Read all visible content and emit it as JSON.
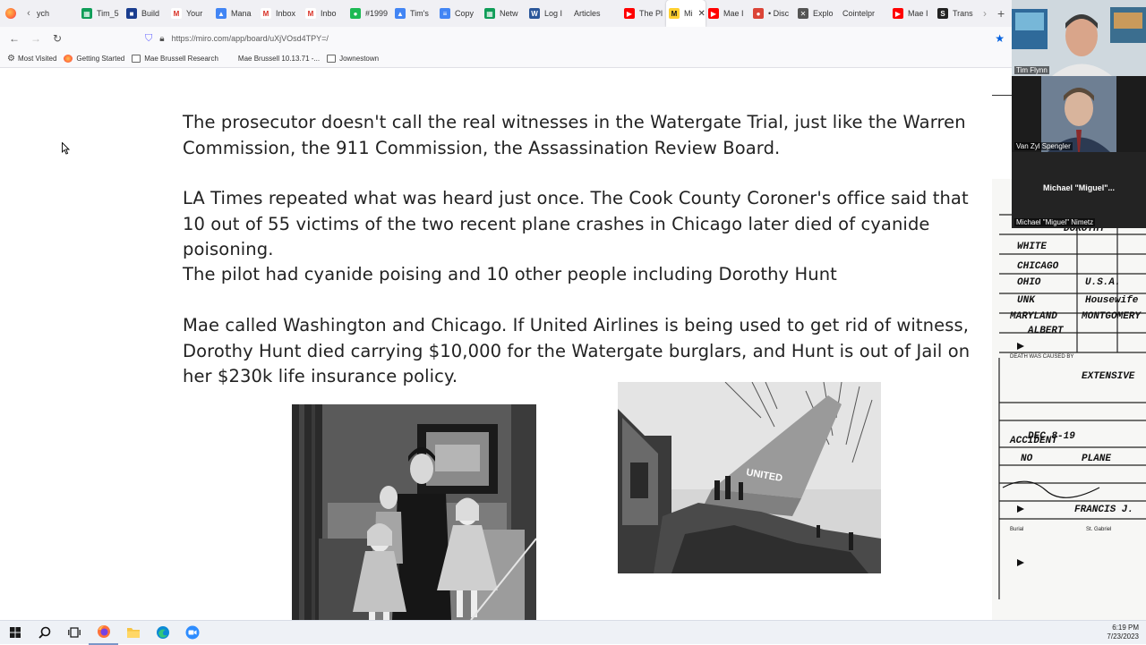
{
  "browser": {
    "tabs": [
      {
        "label": "ych",
        "icon": "none",
        "color": "#9aa0a6",
        "active": false
      },
      {
        "label": "Tim_5",
        "icon": "sheets",
        "color": "#0f9d58",
        "active": false
      },
      {
        "label": "Build",
        "icon": "square",
        "color": "#1a3d8f",
        "active": false
      },
      {
        "label": "Your",
        "icon": "gmail",
        "color": "#d93025",
        "active": false
      },
      {
        "label": "Mana",
        "icon": "ads",
        "color": "#4285f4",
        "active": false
      },
      {
        "label": "Inbox",
        "icon": "gmail",
        "color": "#d93025",
        "active": false
      },
      {
        "label": "Inbo",
        "icon": "gmail",
        "color": "#d93025",
        "active": false
      },
      {
        "label": "#1999",
        "icon": "spotify",
        "color": "#1db954",
        "active": false
      },
      {
        "label": "Tim's",
        "icon": "drive",
        "color": "#4285f4",
        "active": false
      },
      {
        "label": "Copy",
        "icon": "docs",
        "color": "#4285f4",
        "active": false
      },
      {
        "label": "Netw",
        "icon": "sheets",
        "color": "#0f9d58",
        "active": false
      },
      {
        "label": "Log I",
        "icon": "word",
        "color": "#2b579a",
        "active": false
      },
      {
        "label": "Articles",
        "icon": "none",
        "color": "#9aa0a6",
        "active": false
      },
      {
        "label": "The Pl",
        "icon": "youtube",
        "color": "#ff0000",
        "active": false
      },
      {
        "label": "Mi",
        "icon": "miro",
        "color": "#ffd02f",
        "active": true
      },
      {
        "label": "Mae I",
        "icon": "youtube",
        "color": "#ff0000",
        "active": false
      },
      {
        "label": "• Disc",
        "icon": "chrome",
        "color": "#db4437",
        "active": false
      },
      {
        "label": "Explo",
        "icon": "x",
        "color": "#555555",
        "active": false
      },
      {
        "label": "Cointelpr",
        "icon": "none",
        "color": "#9aa0a6",
        "active": false
      },
      {
        "label": "Mae I",
        "icon": "youtube",
        "color": "#ff0000",
        "active": false
      },
      {
        "label": "Trans",
        "icon": "s",
        "color": "#222222",
        "active": false
      }
    ],
    "active_tab_close": "✕",
    "new_tab": "+",
    "url": "https://miro.com/app/board/uXjVOsd4TPY=/",
    "bookmarks": [
      {
        "label": "Most Visited",
        "icon": "gear"
      },
      {
        "label": "Getting Started",
        "icon": "firefox"
      },
      {
        "label": "Mae Brussell Research",
        "icon": "folder"
      },
      {
        "label": "Mae Brussell 10.13.71 -...",
        "icon": "youtube"
      },
      {
        "label": "Jownestown",
        "icon": "folder"
      }
    ]
  },
  "board": {
    "paragraphs": [
      "The prosecutor doesn't call the real witnesses in the Watergate Trial, just like the Warren Commission, the 911 Commission, the Assassination Review Board.",
      "LA Times repeated what was heard just once. The Cook County Coroner's office said that 10 out of 55 victims of the two recent plane crashes in Chicago later died of cyanide poisoning.",
      "The pilot had cyanide poising and 10 other people including Dorothy Hunt",
      "Mae called Washington and Chicago. If United Airlines is being used to get rid of witness, Dorothy Hunt died carrying $10,000 for the Watergate burglars, and Hunt is out of Jail on her $230k life insurance policy."
    ],
    "crash_tail_text": "UNITED"
  },
  "zoom": {
    "participants": [
      {
        "name": "Tim Flynn"
      },
      {
        "name": "Van Zyl Spengler"
      },
      {
        "name": "Michael \"Miguel\" Nimetz",
        "display": "Michael  \"Miguel\"..."
      }
    ]
  },
  "document_scan": {
    "lines": [
      "DOROTHY",
      "WHITE",
      "CHICAGO",
      "OHIO",
      "U.S.A.",
      "UNK",
      "Housewife",
      "MARYLAND",
      "MONTGOMERY",
      "ALBERT",
      "DEATH WAS CAUSED BY",
      "EXTENSIVE",
      "ACCIDENT",
      "DEC 8-19",
      "NO",
      "PLANE",
      "Burial",
      "St. Gabriel",
      "FRANCIS J."
    ]
  },
  "taskbar": {
    "clock_time": "6:19 PM",
    "clock_date": "7/23/2023"
  }
}
